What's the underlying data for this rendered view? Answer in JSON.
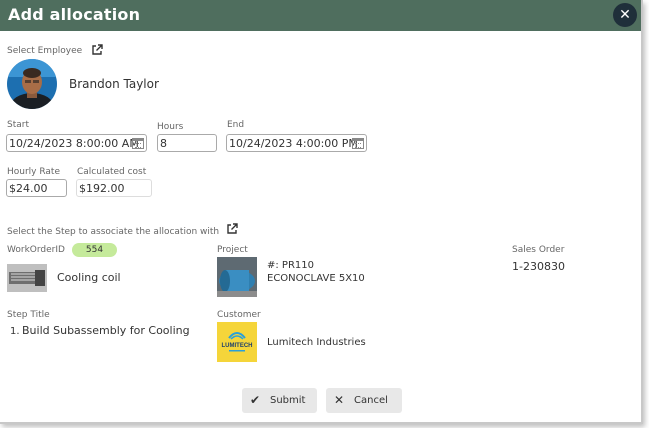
{
  "dialog": {
    "title": "Add allocation",
    "close": "✕"
  },
  "employee": {
    "label": "Select Employee",
    "name": "Brandon Taylor"
  },
  "start": {
    "label": "Start",
    "value": "10/24/2023 8:00:00 AM"
  },
  "hours": {
    "label": "Hours",
    "value": "8"
  },
  "end": {
    "label": "End",
    "value": "10/24/2023 4:00:00 PM"
  },
  "rate": {
    "label": "Hourly Rate",
    "value": "$24.00"
  },
  "cost": {
    "label": "Calculated cost",
    "value": "$192.00"
  },
  "step_section": {
    "label": "Select the Step to associate the allocation with"
  },
  "work_order": {
    "label": "WorkOrderID",
    "id": "554",
    "item": "Cooling coil"
  },
  "project": {
    "label": "Project",
    "number": "#: PR110",
    "name": "ECONOCLAVE 5X10"
  },
  "sales_order": {
    "label": "Sales Order",
    "value": "1-230830"
  },
  "step_title": {
    "label": "Step Title",
    "number": "1.",
    "value": "Build Subassembly for Cooling"
  },
  "customer": {
    "label": "Customer",
    "name": "Lumitech Industries",
    "logo_text": "LUMITECH"
  },
  "buttons": {
    "submit": "Submit",
    "cancel": "Cancel"
  },
  "colors": {
    "titlebar": "#4f6e5e",
    "badge": "#c5ea9b"
  }
}
